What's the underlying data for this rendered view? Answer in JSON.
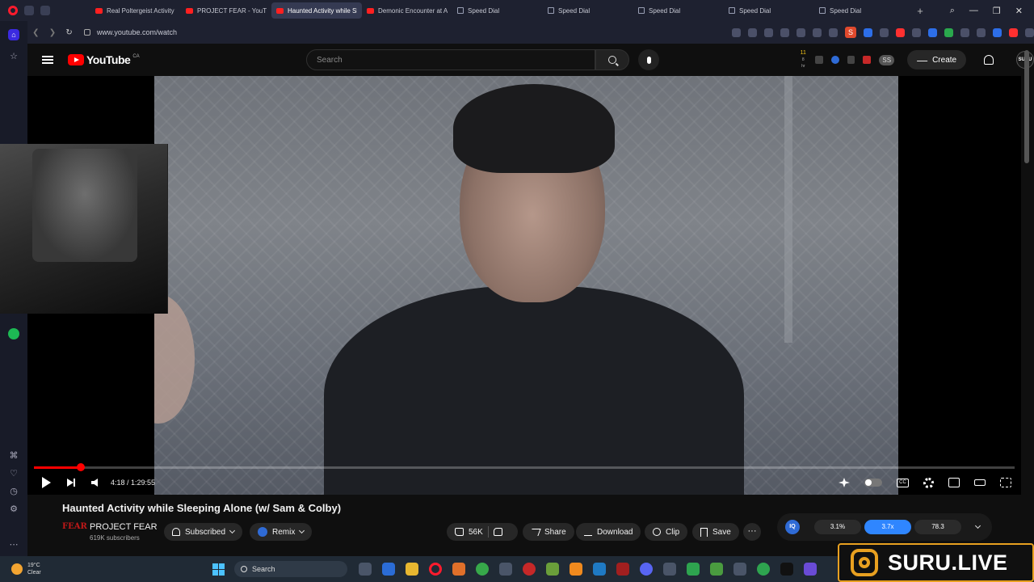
{
  "browser": {
    "tabs": [
      {
        "label": "Real Poltergeist Activity w/",
        "favicon": "youtube-icon",
        "active": false
      },
      {
        "label": "PROJECT FEAR - YouTube",
        "favicon": "youtube-icon",
        "active": false
      },
      {
        "label": "Haunted Activity while Sle",
        "favicon": "youtube-icon",
        "active": true
      },
      {
        "label": "Demonic Encounter at A",
        "favicon": "youtube-icon",
        "active": false
      },
      {
        "label": "Speed Dial",
        "favicon": "speed-dial-icon",
        "active": false
      },
      {
        "label": "Speed Dial",
        "favicon": "speed-dial-icon",
        "active": false
      },
      {
        "label": "Speed Dial",
        "favicon": "speed-dial-icon",
        "active": false
      },
      {
        "label": "Speed Dial",
        "favicon": "speed-dial-icon",
        "active": false
      },
      {
        "label": "Speed Dial",
        "favicon": "speed-dial-icon",
        "active": false
      }
    ],
    "new_tab": "+",
    "window_controls": {
      "search": "⌕",
      "minimize": "—",
      "restore": "❐",
      "close": "✕"
    },
    "url": "www.youtube.com/watch",
    "nav": {
      "back": "❮",
      "forward": "❯",
      "reload": "↻"
    },
    "extension_s": "S"
  },
  "youtube": {
    "logo_text": "YouTube",
    "logo_suffix": "CA",
    "search_placeholder": "Search",
    "header_badge_count": "11",
    "header_badge_sub": "8 hr",
    "ss_chip": "SS",
    "create_label": "Create",
    "avatar_text": "SURU"
  },
  "player": {
    "progress": 0.048,
    "time_display": "4:18 / 1:29:55"
  },
  "video": {
    "title": "Haunted Activity while Sleeping Alone (w/ Sam & Colby)",
    "channel_logo_text": "FEAR",
    "channel_name": "PROJECT FEAR",
    "subscribers": "619K subscribers",
    "subscribed_label": "Subscribed",
    "remix_label": "Remix",
    "likes": "56K",
    "share_label": "Share",
    "download_label": "Download",
    "clip_label": "Clip",
    "save_label": "Save",
    "more": "···"
  },
  "iq_widget": {
    "icon_text": "IQ",
    "stats": [
      "3.1%",
      "3.7x",
      "78.3"
    ]
  },
  "taskbar": {
    "weather_temp": "19°C",
    "weather_condition": "Clear",
    "search_label": "Search"
  },
  "overlay": {
    "banner_text": "SURU.LIVE"
  },
  "colors": {
    "youtube_red": "#ff0000",
    "accent_blue": "#2f86ff",
    "banner_gold": "#e8a020"
  }
}
